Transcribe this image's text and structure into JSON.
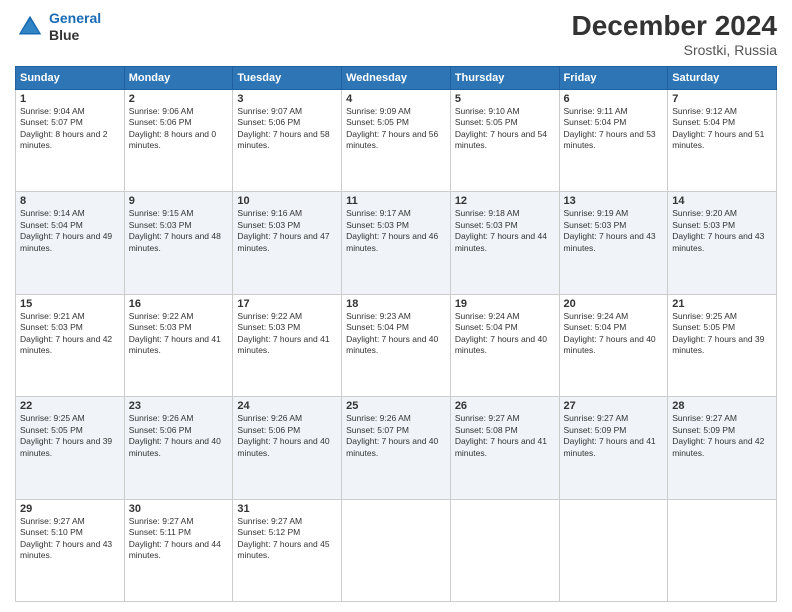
{
  "header": {
    "logo_line1": "General",
    "logo_line2": "Blue",
    "title": "December 2024",
    "subtitle": "Srostki, Russia"
  },
  "days_of_week": [
    "Sunday",
    "Monday",
    "Tuesday",
    "Wednesday",
    "Thursday",
    "Friday",
    "Saturday"
  ],
  "weeks": [
    [
      {
        "day": "1",
        "sunrise": "Sunrise: 9:04 AM",
        "sunset": "Sunset: 5:07 PM",
        "daylight": "Daylight: 8 hours and 2 minutes."
      },
      {
        "day": "2",
        "sunrise": "Sunrise: 9:06 AM",
        "sunset": "Sunset: 5:06 PM",
        "daylight": "Daylight: 8 hours and 0 minutes."
      },
      {
        "day": "3",
        "sunrise": "Sunrise: 9:07 AM",
        "sunset": "Sunset: 5:06 PM",
        "daylight": "Daylight: 7 hours and 58 minutes."
      },
      {
        "day": "4",
        "sunrise": "Sunrise: 9:09 AM",
        "sunset": "Sunset: 5:05 PM",
        "daylight": "Daylight: 7 hours and 56 minutes."
      },
      {
        "day": "5",
        "sunrise": "Sunrise: 9:10 AM",
        "sunset": "Sunset: 5:05 PM",
        "daylight": "Daylight: 7 hours and 54 minutes."
      },
      {
        "day": "6",
        "sunrise": "Sunrise: 9:11 AM",
        "sunset": "Sunset: 5:04 PM",
        "daylight": "Daylight: 7 hours and 53 minutes."
      },
      {
        "day": "7",
        "sunrise": "Sunrise: 9:12 AM",
        "sunset": "Sunset: 5:04 PM",
        "daylight": "Daylight: 7 hours and 51 minutes."
      }
    ],
    [
      {
        "day": "8",
        "sunrise": "Sunrise: 9:14 AM",
        "sunset": "Sunset: 5:04 PM",
        "daylight": "Daylight: 7 hours and 49 minutes."
      },
      {
        "day": "9",
        "sunrise": "Sunrise: 9:15 AM",
        "sunset": "Sunset: 5:03 PM",
        "daylight": "Daylight: 7 hours and 48 minutes."
      },
      {
        "day": "10",
        "sunrise": "Sunrise: 9:16 AM",
        "sunset": "Sunset: 5:03 PM",
        "daylight": "Daylight: 7 hours and 47 minutes."
      },
      {
        "day": "11",
        "sunrise": "Sunrise: 9:17 AM",
        "sunset": "Sunset: 5:03 PM",
        "daylight": "Daylight: 7 hours and 46 minutes."
      },
      {
        "day": "12",
        "sunrise": "Sunrise: 9:18 AM",
        "sunset": "Sunset: 5:03 PM",
        "daylight": "Daylight: 7 hours and 44 minutes."
      },
      {
        "day": "13",
        "sunrise": "Sunrise: 9:19 AM",
        "sunset": "Sunset: 5:03 PM",
        "daylight": "Daylight: 7 hours and 43 minutes."
      },
      {
        "day": "14",
        "sunrise": "Sunrise: 9:20 AM",
        "sunset": "Sunset: 5:03 PM",
        "daylight": "Daylight: 7 hours and 43 minutes."
      }
    ],
    [
      {
        "day": "15",
        "sunrise": "Sunrise: 9:21 AM",
        "sunset": "Sunset: 5:03 PM",
        "daylight": "Daylight: 7 hours and 42 minutes."
      },
      {
        "day": "16",
        "sunrise": "Sunrise: 9:22 AM",
        "sunset": "Sunset: 5:03 PM",
        "daylight": "Daylight: 7 hours and 41 minutes."
      },
      {
        "day": "17",
        "sunrise": "Sunrise: 9:22 AM",
        "sunset": "Sunset: 5:03 PM",
        "daylight": "Daylight: 7 hours and 41 minutes."
      },
      {
        "day": "18",
        "sunrise": "Sunrise: 9:23 AM",
        "sunset": "Sunset: 5:04 PM",
        "daylight": "Daylight: 7 hours and 40 minutes."
      },
      {
        "day": "19",
        "sunrise": "Sunrise: 9:24 AM",
        "sunset": "Sunset: 5:04 PM",
        "daylight": "Daylight: 7 hours and 40 minutes."
      },
      {
        "day": "20",
        "sunrise": "Sunrise: 9:24 AM",
        "sunset": "Sunset: 5:04 PM",
        "daylight": "Daylight: 7 hours and 40 minutes."
      },
      {
        "day": "21",
        "sunrise": "Sunrise: 9:25 AM",
        "sunset": "Sunset: 5:05 PM",
        "daylight": "Daylight: 7 hours and 39 minutes."
      }
    ],
    [
      {
        "day": "22",
        "sunrise": "Sunrise: 9:25 AM",
        "sunset": "Sunset: 5:05 PM",
        "daylight": "Daylight: 7 hours and 39 minutes."
      },
      {
        "day": "23",
        "sunrise": "Sunrise: 9:26 AM",
        "sunset": "Sunset: 5:06 PM",
        "daylight": "Daylight: 7 hours and 40 minutes."
      },
      {
        "day": "24",
        "sunrise": "Sunrise: 9:26 AM",
        "sunset": "Sunset: 5:06 PM",
        "daylight": "Daylight: 7 hours and 40 minutes."
      },
      {
        "day": "25",
        "sunrise": "Sunrise: 9:26 AM",
        "sunset": "Sunset: 5:07 PM",
        "daylight": "Daylight: 7 hours and 40 minutes."
      },
      {
        "day": "26",
        "sunrise": "Sunrise: 9:27 AM",
        "sunset": "Sunset: 5:08 PM",
        "daylight": "Daylight: 7 hours and 41 minutes."
      },
      {
        "day": "27",
        "sunrise": "Sunrise: 9:27 AM",
        "sunset": "Sunset: 5:09 PM",
        "daylight": "Daylight: 7 hours and 41 minutes."
      },
      {
        "day": "28",
        "sunrise": "Sunrise: 9:27 AM",
        "sunset": "Sunset: 5:09 PM",
        "daylight": "Daylight: 7 hours and 42 minutes."
      }
    ],
    [
      {
        "day": "29",
        "sunrise": "Sunrise: 9:27 AM",
        "sunset": "Sunset: 5:10 PM",
        "daylight": "Daylight: 7 hours and 43 minutes."
      },
      {
        "day": "30",
        "sunrise": "Sunrise: 9:27 AM",
        "sunset": "Sunset: 5:11 PM",
        "daylight": "Daylight: 7 hours and 44 minutes."
      },
      {
        "day": "31",
        "sunrise": "Sunrise: 9:27 AM",
        "sunset": "Sunset: 5:12 PM",
        "daylight": "Daylight: 7 hours and 45 minutes."
      },
      null,
      null,
      null,
      null
    ]
  ]
}
